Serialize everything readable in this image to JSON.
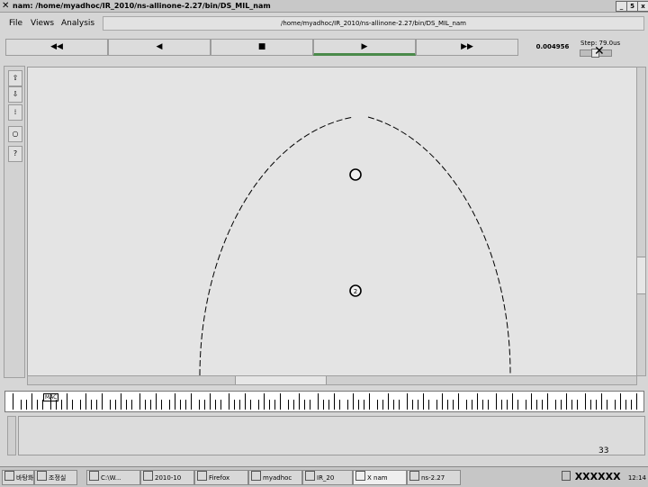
{
  "window": {
    "title": "nam: /home/myadhoc/IR_2010/ns-allinone-2.27/bin/DS_MIL_nam",
    "buttons": [
      "_",
      "5",
      "x"
    ]
  },
  "menu": {
    "file": "File",
    "views": "Views",
    "analysis": "Analysis",
    "path": "/home/myadhoc/IR_2010/ns-allinone-2.27/bin/DS_MIL_nam"
  },
  "transport": {
    "rewind": "◀◀",
    "back": "◀",
    "stop": "■",
    "play": "▶",
    "fastforward": "▶▶",
    "time": "0.004956",
    "step_label": "Step: 79.0us"
  },
  "toolbar": {
    "tools": [
      "zoom-in-icon",
      "zoom-out-icon",
      "edit-icon",
      "circle-tool-icon",
      "help-icon"
    ]
  },
  "nodes": [
    {
      "id": "node-0",
      "label": ""
    },
    {
      "id": "node-2",
      "label": "2"
    }
  ],
  "timeline": {
    "label": "MAC"
  },
  "annotation": {
    "slide_number": "33"
  },
  "taskbar": {
    "items": [
      {
        "label": "바탕화면",
        "icon": "desktop-icon"
      },
      {
        "label": "조정실",
        "icon": "file-icon"
      },
      {
        "label": "C:\\W...",
        "icon": "folder-icon"
      },
      {
        "label": "2010-10",
        "icon": "doc-icon"
      },
      {
        "label": "Firefox",
        "icon": "firefox-icon"
      },
      {
        "label": "myadhoc",
        "icon": "terminal-icon"
      },
      {
        "label": "IR_20",
        "icon": "shell-icon"
      },
      {
        "label": "X nam",
        "icon": "x-icon"
      },
      {
        "label": "ns-2.27",
        "icon": "folder-icon"
      }
    ],
    "tray_text": "XXXXXX",
    "clock": "12:14"
  },
  "colors": {
    "canvas_bg": "#e4e4e4",
    "play_active": "#4a8a4a"
  }
}
